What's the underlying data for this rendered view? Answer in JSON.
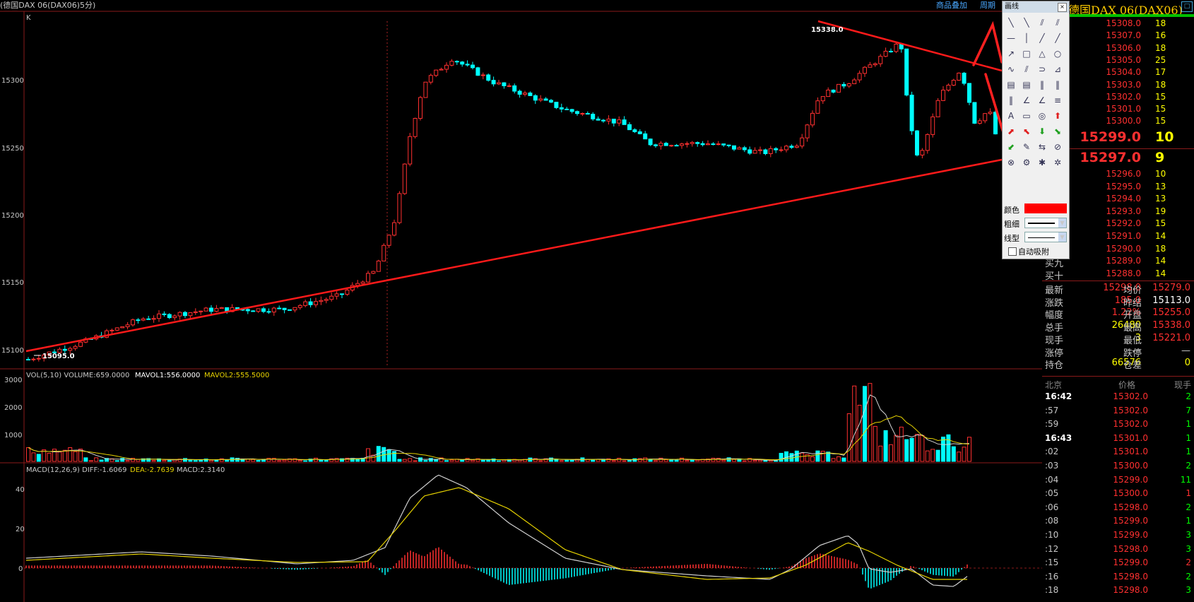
{
  "header": {
    "title": "(德国DAX 06(DAX06)5分)",
    "link_overlay": "商品叠加",
    "link_period": "周期"
  },
  "main_chart": {
    "tag": "K",
    "price_ticks": [
      "15300",
      "15250",
      "15200",
      "15150",
      "15100"
    ],
    "high_label": "15338.0",
    "low_label": "15095.0"
  },
  "volume_panel": {
    "legend_prefix": "VOL(5,10) VOLUME:659.0000",
    "mavol1": "MAVOL1:556.0000",
    "mavol2": "MAVOL2:555.5000",
    "ticks": [
      "3000",
      "2000",
      "1000"
    ]
  },
  "macd_panel": {
    "legend_prefix": "MACD(12,26,9) DIFF:-1.6069",
    "dea": "DEA:-2.7639",
    "macd": "MACD:2.3140",
    "ticks": [
      "40",
      "20",
      "0"
    ]
  },
  "quote": {
    "name": "德国DAX 06(DAX06)",
    "asks": [
      {
        "price": "15308.0",
        "vol": "18"
      },
      {
        "price": "15307.0",
        "vol": "16"
      },
      {
        "price": "15306.0",
        "vol": "18"
      },
      {
        "price": "15305.0",
        "vol": "25"
      },
      {
        "price": "15304.0",
        "vol": "17"
      },
      {
        "price": "15303.0",
        "vol": "18"
      },
      {
        "price": "15302.0",
        "vol": "15"
      },
      {
        "price": "15301.0",
        "vol": "15"
      },
      {
        "price": "15300.0",
        "vol": "15"
      }
    ],
    "ask1": {
      "price": "15299.0",
      "vol": "10"
    },
    "bid1": {
      "price": "15297.0",
      "vol": "9"
    },
    "bids": [
      {
        "label": "",
        "price": "15296.0",
        "vol": "10"
      },
      {
        "label": "",
        "price": "15295.0",
        "vol": "13"
      },
      {
        "label": "",
        "price": "15294.0",
        "vol": "13"
      },
      {
        "label": "",
        "price": "15293.0",
        "vol": "19"
      },
      {
        "label": "",
        "price": "15292.0",
        "vol": "15"
      },
      {
        "label": "",
        "price": "15291.0",
        "vol": "14"
      },
      {
        "label": "",
        "price": "15290.0",
        "vol": "18"
      },
      {
        "label": "买九",
        "price": "15289.0",
        "vol": "14"
      },
      {
        "label": "买十",
        "price": "15288.0",
        "vol": "14"
      }
    ],
    "stats": [
      {
        "l1": "最新",
        "v1": "15298.0",
        "c1": "#ff3030",
        "l2": "均价",
        "v2": "15279.0",
        "c2": "#ff3030"
      },
      {
        "l1": "涨跌",
        "v1": "185.0",
        "c1": "#ff3030",
        "l2": "昨结",
        "v2": "15113.0",
        "c2": "#ffffff"
      },
      {
        "l1": "幅度",
        "v1": "1.22%",
        "c1": "#ff3030",
        "l2": "开盘",
        "v2": "15255.0",
        "c2": "#ff3030"
      },
      {
        "l1": "总手",
        "v1": "26480",
        "c1": "#ffff00",
        "l2": "最高",
        "v2": "15338.0",
        "c2": "#ff3030"
      },
      {
        "l1": "现手",
        "v1": "3",
        "c1": "#ffff00",
        "l2": "最低",
        "v2": "15221.0",
        "c2": "#ff3030"
      },
      {
        "l1": "涨停",
        "v1": "—",
        "c1": "#c8c8c8",
        "l2": "跌停",
        "v2": "—",
        "c2": "#c8c8c8"
      },
      {
        "l1": "持仓",
        "v1": "66576",
        "c1": "#ffff00",
        "l2": "仓差",
        "v2": "0",
        "c2": "#ffff00"
      }
    ],
    "ticks_header": {
      "time": "北京",
      "price": "价格",
      "vol": "现手"
    },
    "ticks": [
      {
        "t": "16:42",
        "p": "15302.0",
        "v": "2",
        "c": "#00ff00",
        "bold": true
      },
      {
        "t": ":57",
        "p": "15302.0",
        "v": "7",
        "c": "#00ff00",
        "bold": false
      },
      {
        "t": ":59",
        "p": "15302.0",
        "v": "1",
        "c": "#00ff00",
        "bold": false
      },
      {
        "t": "16:43",
        "p": "15301.0",
        "v": "1",
        "c": "#00ff00",
        "bold": true
      },
      {
        "t": ":02",
        "p": "15301.0",
        "v": "1",
        "c": "#00ff00",
        "bold": false
      },
      {
        "t": ":03",
        "p": "15300.0",
        "v": "2",
        "c": "#00ff00",
        "bold": false
      },
      {
        "t": ":04",
        "p": "15299.0",
        "v": "11",
        "c": "#00ff00",
        "bold": false
      },
      {
        "t": ":05",
        "p": "15300.0",
        "v": "1",
        "c": "#ff3030",
        "bold": false
      },
      {
        "t": ":06",
        "p": "15298.0",
        "v": "2",
        "c": "#00ff00",
        "bold": false
      },
      {
        "t": ":08",
        "p": "15299.0",
        "v": "1",
        "c": "#00ff00",
        "bold": false
      },
      {
        "t": ":10",
        "p": "15299.0",
        "v": "3",
        "c": "#00ff00",
        "bold": false
      },
      {
        "t": ":12",
        "p": "15298.0",
        "v": "3",
        "c": "#00ff00",
        "bold": false
      },
      {
        "t": ":15",
        "p": "15299.0",
        "v": "2",
        "c": "#ff3030",
        "bold": false
      },
      {
        "t": ":16",
        "p": "15298.0",
        "v": "2",
        "c": "#00ff00",
        "bold": false
      },
      {
        "t": ":18",
        "p": "15298.0",
        "v": "3",
        "c": "#00ff00",
        "bold": false
      }
    ]
  },
  "toolbox": {
    "title": "画线",
    "color_label": "颜色",
    "width_label": "粗细",
    "style_label": "线型",
    "auto_attach": "自动吸附"
  },
  "colors": {
    "up": "#ff3030",
    "down": "#00ffff",
    "trendline": "#ff1a1a",
    "ma_white": "#d0d0d0",
    "ma_yellow": "#e6d200",
    "frame": "#8a1a1a"
  }
}
